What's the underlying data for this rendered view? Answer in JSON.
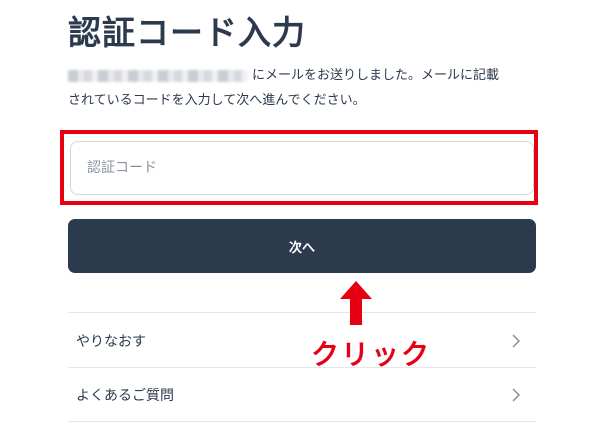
{
  "header": {
    "title": "認証コード入力"
  },
  "description": {
    "line1_suffix": "にメールをお送りしました。メールに記載",
    "line2": "されているコードを入力して次へ進んでください。"
  },
  "form": {
    "code_placeholder": "認証コード",
    "code_value": "",
    "next_label": "次へ"
  },
  "menu": {
    "items": [
      {
        "label": "やりなおす"
      },
      {
        "label": "よくあるご質問"
      }
    ]
  },
  "annotation": {
    "text": "クリック",
    "color": "#e60012"
  },
  "colors": {
    "primary": "#2c3a4d",
    "highlight": "#e60012",
    "border": "#cfd6df"
  }
}
